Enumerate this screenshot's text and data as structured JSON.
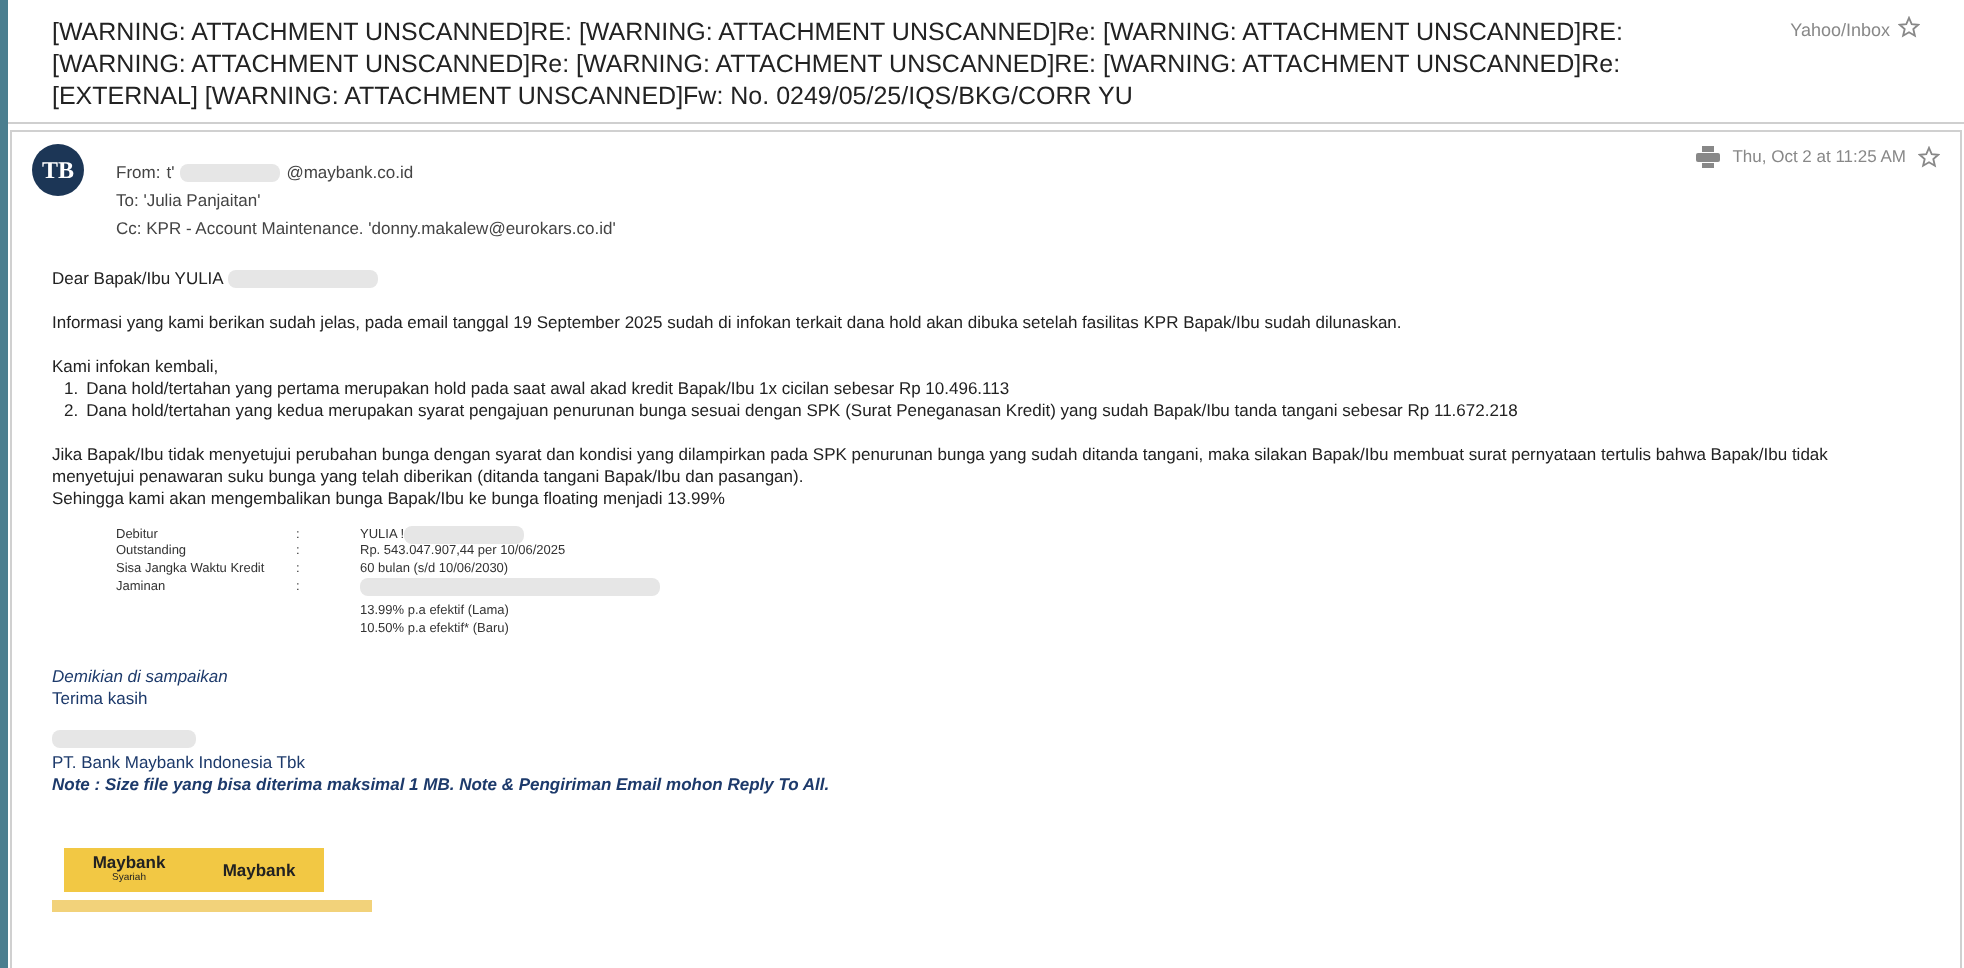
{
  "subject": "[WARNING: ATTACHMENT UNSCANNED]RE: [WARNING: ATTACHMENT UNSCANNED]Re: [WARNING: ATTACHMENT UNSCANNED]RE: [WARNING: ATTACHMENT UNSCANNED]Re: [WARNING: ATTACHMENT UNSCANNED]RE: [WARNING: ATTACHMENT UNSCANNED]Re: [EXTERNAL] [WARNING: ATTACHMENT UNSCANNED]Fw: No. 0249/05/25/IQS/BKG/CORR YU",
  "folder": "Yahoo/Inbox",
  "starred": false,
  "message": {
    "avatar": "TB",
    "from_label": "From:",
    "from_start": "t'",
    "from_domain": "@maybank.co.id",
    "to": "To: 'Julia Panjaitan'",
    "cc": "Cc: KPR - Account Maintenance.  'donny.makalew@eurokars.co.id'",
    "date": "Thu, Oct 2 at 11:25 AM",
    "starred": false
  },
  "body": {
    "greeting": "Dear Bapak/Ibu YULIA",
    "para1": "Informasi yang kami berikan sudah jelas, pada email tanggal 19 September 2025 sudah di infokan terkait dana hold akan dibuka setelah fasilitas KPR Bapak/Ibu sudah dilunaskan.",
    "intro": "Kami infokan kembali,",
    "list": [
      {
        "number": "1.",
        "text": "Dana hold/tertahan yang pertama merupakan hold pada saat awal akad kredit Bapak/Ibu 1x cicilan sebesar Rp 10.496.113"
      },
      {
        "number": "2.",
        "text": "Dana hold/tertahan yang kedua merupakan syarat pengajuan penurunan bunga sesuai dengan SPK (Surat Peneganasan Kredit) yang sudah Bapak/Ibu tanda tangani sebesar Rp 11.672.218"
      }
    ],
    "para2": "Jika Bapak/Ibu tidak menyetujui perubahan bunga dengan syarat dan kondisi yang dilampirkan pada SPK penurunan bunga yang sudah ditanda tangani, maka silakan Bapak/Ibu membuat surat pernyataan tertulis bahwa Bapak/Ibu tidak menyetujui penawaran suku bunga yang telah diberikan (ditanda tangani Bapak/Ibu dan pasangan).",
    "para3": "Sehingga kami akan mengembalikan bunga Bapak/Ibu ke bunga floating menjadi 13.99%",
    "details": [
      {
        "label": "Debitur",
        "separator": ":",
        "value": "YULIA !",
        "redacted": true
      },
      {
        "label": "Outstanding",
        "separator": ":",
        "value": "Rp. 543.047.907,44 per 10/06/2025",
        "redacted": false
      },
      {
        "label": "Sisa Jangka Waktu Kredit",
        "separator": ":",
        "value": "60  bulan (s/d 10/06/2030)",
        "redacted": false
      },
      {
        "label": "Jaminan",
        "separator": ":",
        "redacted": true
      }
    ],
    "rates": [
      "13.99% p.a efektif  (Lama)",
      "10.50% p.a efektif* (Baru)"
    ],
    "closing": "Demikian di sampaikan",
    "thanks": "Terima kasih",
    "company": "PT. Bank Maybank Indonesia Tbk",
    "note": "Note : Size file yang bisa diterima maksimal 1 MB. Note & Pengiriman Email mohon Reply To All.",
    "logos": [
      {
        "name": "Maybank",
        "sub": "Syariah"
      },
      {
        "name": "Maybank"
      }
    ]
  }
}
